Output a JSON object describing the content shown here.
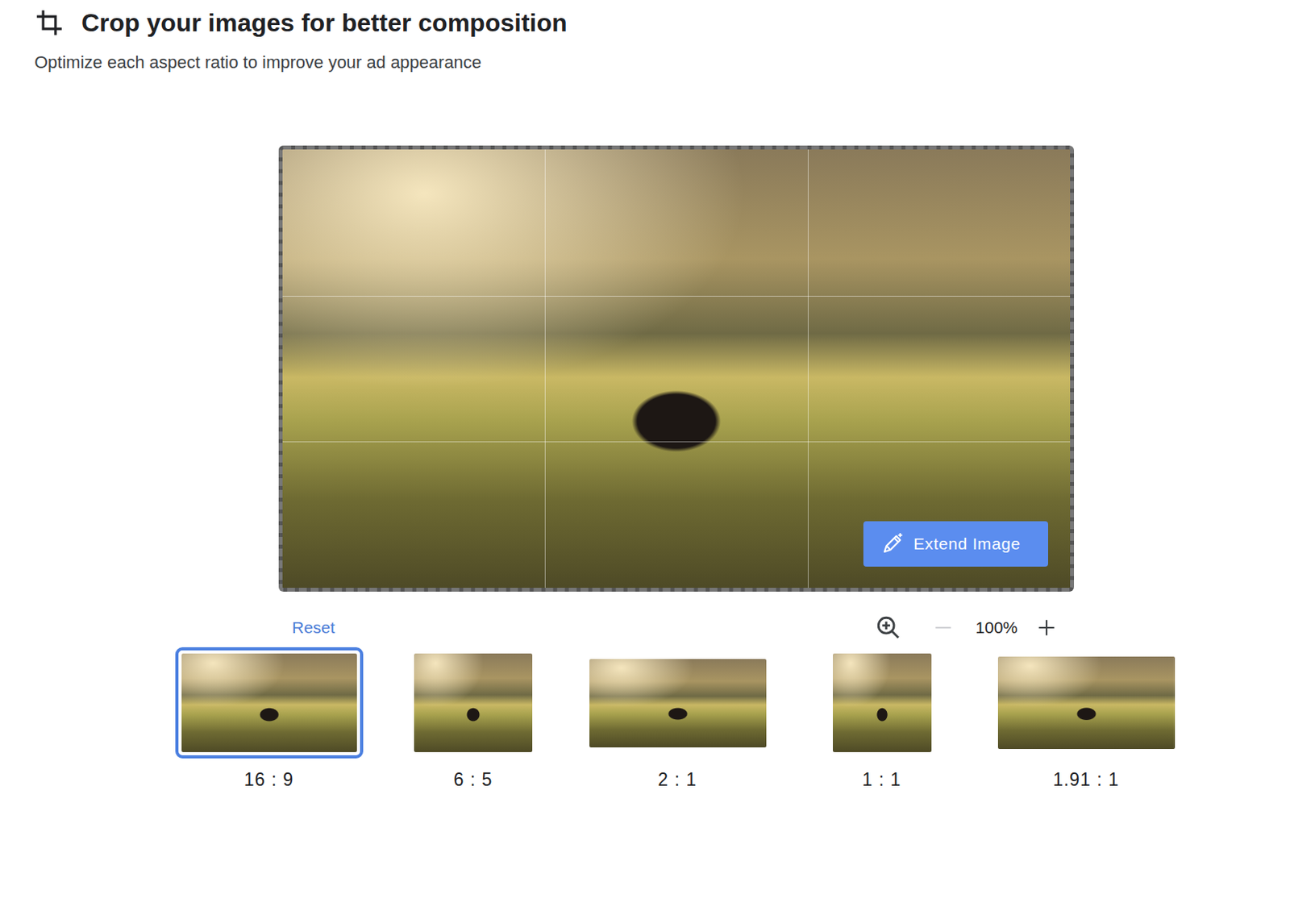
{
  "header": {
    "title": "Crop your images for better composition",
    "subtitle": "Optimize each aspect ratio to improve your ad appearance"
  },
  "editor": {
    "extend_button": "Extend Image"
  },
  "controls": {
    "reset": "Reset",
    "zoom": "100%",
    "zoom_out_disabled": true,
    "zoom_in_disabled": false
  },
  "ratios": [
    {
      "label": "16 : 9",
      "selected": true
    },
    {
      "label": "6 : 5",
      "selected": false
    },
    {
      "label": "2 : 1",
      "selected": false
    },
    {
      "label": "1 : 1",
      "selected": false
    },
    {
      "label": "1.91 : 1",
      "selected": false
    }
  ]
}
